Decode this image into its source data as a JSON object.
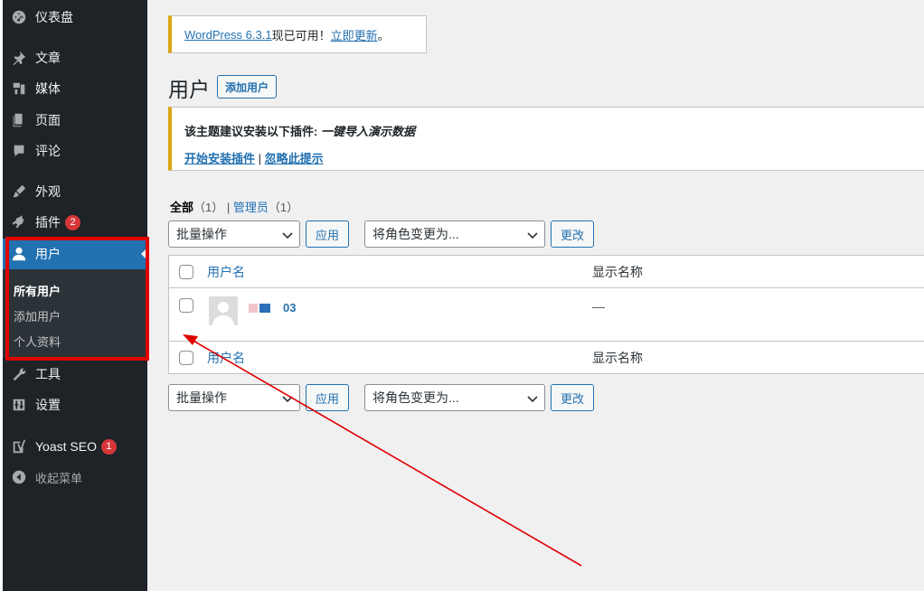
{
  "sidebar": {
    "items": [
      {
        "label": "仪表盘",
        "icon": "dashboard-icon"
      },
      {
        "label": "文章",
        "icon": "pin-icon"
      },
      {
        "label": "媒体",
        "icon": "media-icon"
      },
      {
        "label": "页面",
        "icon": "page-icon"
      },
      {
        "label": "评论",
        "icon": "comment-icon"
      },
      {
        "label": "外观",
        "icon": "brush-icon"
      },
      {
        "label": "插件",
        "icon": "plugin-icon",
        "badge": "2"
      },
      {
        "label": "用户",
        "icon": "user-icon",
        "active": true
      },
      {
        "label": "工具",
        "icon": "wrench-icon"
      },
      {
        "label": "设置",
        "icon": "settings-icon"
      },
      {
        "label": "Yoast SEO",
        "icon": "yoast-icon",
        "badge": "1"
      },
      {
        "label": "收起菜单",
        "icon": "collapse-icon"
      }
    ],
    "submenu": [
      "所有用户",
      "添加用户",
      "个人资料"
    ]
  },
  "notice_update": {
    "link1": "WordPress 6.3.1",
    "text": "现已可用！",
    "link2": "立即更新",
    "end": "。"
  },
  "page": {
    "title": "用户",
    "add_button": "添加用户"
  },
  "notice_plugin": {
    "text": "该主题建议安装以下插件: ",
    "plugin": "一键导入演示数据",
    "link_install": "开始安装插件",
    "sep": " | ",
    "link_dismiss": "忽略此提示"
  },
  "filters": {
    "all": "全部",
    "all_count": "（1）",
    "sep": " | ",
    "admin": "管理员",
    "admin_count": "（1）"
  },
  "actions": {
    "bulk": "批量操作",
    "apply": "应用",
    "role": "将角色变更为...",
    "change": "更改"
  },
  "table": {
    "col_username": "用户名",
    "col_display": "显示名称",
    "rows": [
      {
        "username": "03",
        "display": "—"
      }
    ]
  },
  "colors": {
    "sidebar_bg": "#1d2327",
    "accent": "#2271b1",
    "notice_border": "#dba617",
    "badge": "#d63638",
    "annotation": "#e00000"
  }
}
